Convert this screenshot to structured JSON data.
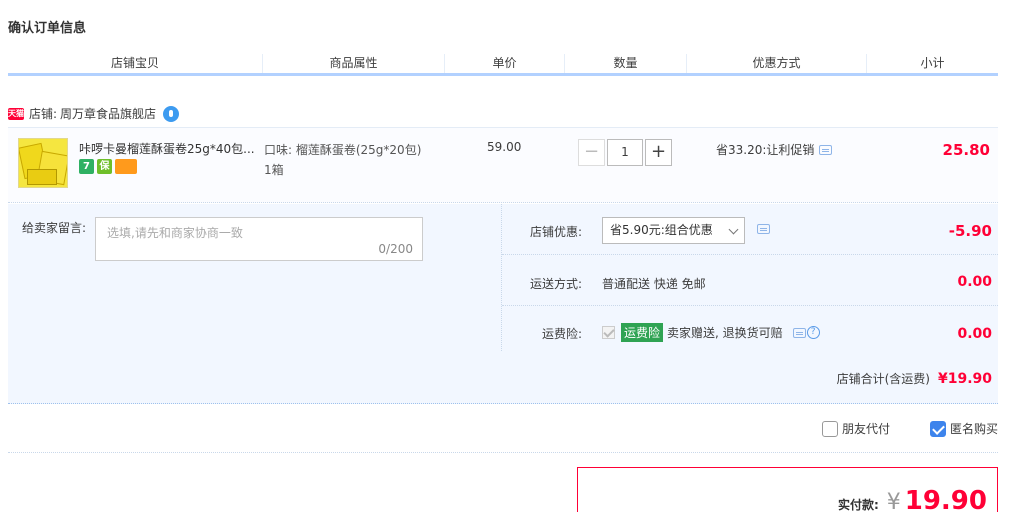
{
  "page_title": "确认订单信息",
  "columns": [
    "店铺宝贝",
    "商品属性",
    "单价",
    "数量",
    "优惠方式",
    "小计"
  ],
  "shop": {
    "badge_text": "天猫",
    "label": "店铺:",
    "name": "周万章食品旗舰店"
  },
  "item": {
    "title": "咔啰卡曼榴莲酥蛋卷25g*40包...",
    "badges": [
      "7",
      "保",
      ""
    ],
    "attribute": "口味: 榴莲酥蛋卷(25g*20包)",
    "quantity_unit": "1箱",
    "unit_price": "59.00",
    "quantity": "1",
    "minus": "−",
    "plus": "+",
    "promo": "省33.20:让利促销",
    "subtotal": "25.80"
  },
  "message": {
    "label": "给卖家留言:",
    "placeholder": "选填,请先和商家协商一致",
    "count": "0/200"
  },
  "shop_discount": {
    "label": "店铺优惠:",
    "selected": "省5.90元:组合优惠",
    "value": "-5.90"
  },
  "shipping": {
    "label": "运送方式:",
    "text": "普通配送 快递 免邮",
    "value": "0.00"
  },
  "insurance": {
    "label": "运费险:",
    "badge": "运费险",
    "text": "卖家赠送, 退换货可赔",
    "value": "0.00"
  },
  "shop_total": {
    "label": "店铺合计(含运费)",
    "value": "¥19.90"
  },
  "pay_options": {
    "friend_pay": "朋友代付",
    "friend_pay_checked": false,
    "anonymous": "匿名购买",
    "anonymous_checked": true
  },
  "grand_total": {
    "label": "实付款:",
    "currency": "¥",
    "amount": "19.90"
  },
  "colors": {
    "accent_red": "#ff0036",
    "header_border": "#b2d1ff",
    "panel_bg": "#f2f7ff",
    "checkbox_blue": "#3d84ec"
  }
}
